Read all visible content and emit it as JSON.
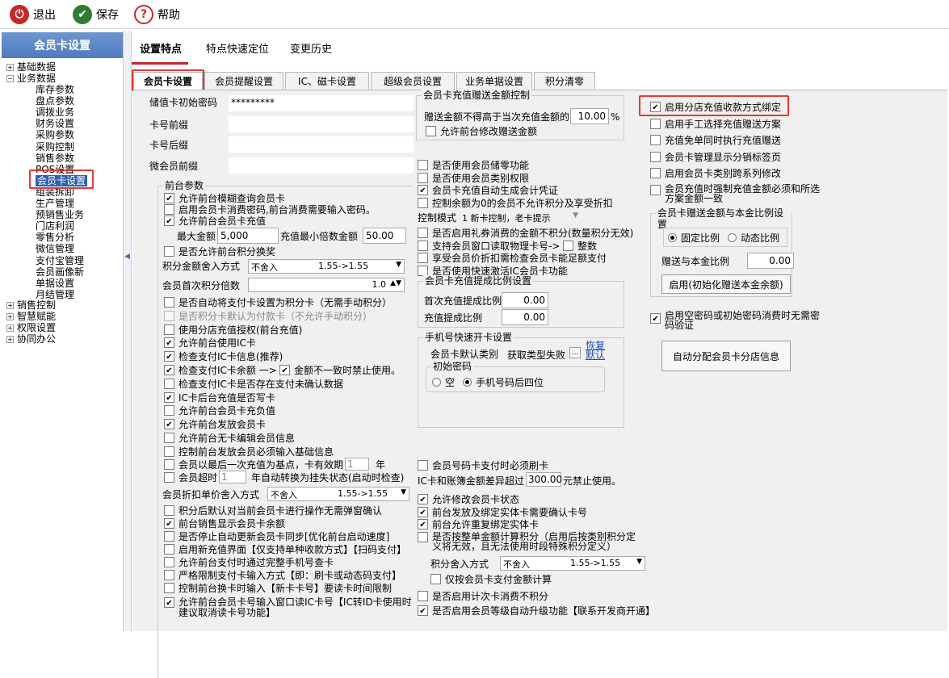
{
  "toolbar": {
    "exit": "退出",
    "save": "保存",
    "help": "帮助"
  },
  "sidebar": {
    "title": "会员卡设置",
    "top": [
      "基础数据",
      "业务数据"
    ],
    "sub": [
      "库存参数",
      "盘点参数",
      "调拨业务",
      "财务设置",
      "采购参数",
      "采购控制",
      "销售参数",
      "POS设置",
      "会员卡设置",
      "组装拆卸",
      "生产管理",
      "预销售业务",
      "门店利润",
      "零售分析",
      "微信管理",
      "支付宝管理",
      "会员画像新",
      "单据设置",
      "月结管理"
    ],
    "bottom": [
      "销售控制",
      "智慧赋能",
      "权限设置",
      "协同办公"
    ]
  },
  "tabs": {
    "top": [
      "设置特点",
      "特点快速定位",
      "变更历史"
    ],
    "sub": [
      "会员卡设置",
      "会员提醒设置",
      "IC、磁卡设置",
      "超级会员设置",
      "业务单据设置",
      "积分清零"
    ]
  },
  "col1": {
    "pwd_label": "储值卡初始密码",
    "pwd_value": "*********",
    "prefix_label": "卡号前缀",
    "suffix_label": "卡号后缀",
    "wx_prefix_label": "微会员前缀",
    "group_title": "前台参数",
    "cb1": "允许前台模糊查询会员卡",
    "cb2": "启用会员卡消费密码,前台消费需要输入密码。",
    "cb3": "允许前台会员卡充值",
    "max_label": "最大金额",
    "max_value": "5,000",
    "min_mult_label": "充值最小倍数金额",
    "min_mult_value": "50.00",
    "cb4": "是否允许前台积分换奖",
    "round_label": "积分金额舍入方式",
    "round_value": "不舍入",
    "round_eg": "1.55->1.55",
    "first_mult_label": "会员首次积分倍数",
    "first_mult_value": "1.0",
    "items": [
      {
        "t": "是否自动将支付卡设置为积分卡（无需手动积分）",
        "on": false
      },
      {
        "t": "是否积分卡默认为付款卡（不允许手动积分）",
        "on": false,
        "dim": true
      },
      {
        "t": "使用分店充值授权(前台充值)",
        "on": false
      },
      {
        "t": "允许前台使用IC卡",
        "on": true
      },
      {
        "t": "检查支付IC卡信息(推荐)",
        "on": true
      },
      {
        "t": "检查支付IC卡余额 一>",
        "on": true
      },
      {
        "t": "检查支付IC卡是否存在支付未确认数据",
        "on": false
      },
      {
        "t": "IC卡后台充值是否写卡",
        "on": true
      },
      {
        "t": "允许前台会员卡充负值",
        "on": false
      },
      {
        "t": "允许前台发放会员卡",
        "on": true
      },
      {
        "t": "允许前台无卡编辑会员信息",
        "on": false
      },
      {
        "t": "控制前台发放会员必须输入基础信息",
        "on": false
      }
    ],
    "mismatch": "金额不一致时禁止使用。",
    "last_recharge": "会员以最后一次充值为基点，卡有效期",
    "last_recharge_val": "1",
    "last_recharge_unit": "年",
    "over": "会员超时",
    "over_val": "1",
    "over_tail": "年自动转换为挂失状态(启动时检查)",
    "disc_label": "会员折扣单价舍入方式",
    "disc_value": "不舍入",
    "disc_eg": "1.55->1.55",
    "items2": [
      {
        "t": "积分后默认对当前会员卡进行操作无需弹窗确认",
        "on": false
      },
      {
        "t": "前台销售显示会员卡余额",
        "on": true
      },
      {
        "t": "是否停止自动更新会员卡同步[优化前台启动速度]",
        "on": false
      },
      {
        "t": "启用新充值界面【仅支持单种收款方式】【扫码支付】",
        "on": false
      },
      {
        "t": "允许前台支付时通过完整手机号查卡",
        "on": false
      },
      {
        "t": "严格限制支付卡输入方式【即：刷卡或动态码支付】",
        "on": false
      },
      {
        "t": "控制前台换卡时输入【新卡卡号】要读卡时间限制",
        "on": false
      }
    ],
    "last": "允许前台会员卡号输入窗口读IC卡号【IC转ID卡使用时建议取消读卡号功能】"
  },
  "col2": {
    "g1_title": "会员卡充值赠送金额控制",
    "gift_label": "赠送金额不得高于当次充值金额的",
    "gift_value": "10.00",
    "gift_unit": "%",
    "gift_cb": "允许前台修改赠送金额",
    "items": [
      {
        "t": "是否使用会员储零功能",
        "on": false
      },
      {
        "t": "是否使用会员类别权限",
        "on": false
      },
      {
        "t": "会员卡充值自动生成会计凭证",
        "on": true
      },
      {
        "t": "控制余额为0的会员不允许积分及享受折扣",
        "on": false
      }
    ],
    "mode_label": "控制模式",
    "mode_value": "1 新卡控制，老卡提示",
    "items2": [
      {
        "t": "是否启用礼券消费的金额不积分(数量积分无效)",
        "on": false
      },
      {
        "t": "支持会员窗口读取物理卡号->",
        "on": false
      },
      {
        "t": "享受会员价折扣需检查会员卡能足额支付",
        "on": false
      },
      {
        "t": "是否使用快速激活IC会员卡功能",
        "on": false
      }
    ],
    "whole": "整数",
    "g2_title": "会员卡充值提成比例设置",
    "first_ratio_label": "首次充值提成比例",
    "first_ratio": "0.00",
    "ratio_label": "充值提成比例",
    "ratio": "0.00",
    "g3_title": "手机号快速开卡设置",
    "default_cat_label": "会员卡默认类别",
    "default_cat": "获取类型失败",
    "restore": "恢复默认",
    "g4_title": "初始密码",
    "pwd_opt1": "空",
    "pwd_opt2": "手机号码后四位",
    "card_pay": "会员号码卡支付时必须刷卡",
    "diff_label": "IC卡和账簿金额差异超过",
    "diff_value": "300.00",
    "diff_tail": "元禁止使用。",
    "items3": [
      {
        "t": "允许修改会员卡状态",
        "on": true
      },
      {
        "t": "前台发放及绑定实体卡需要确认卡号",
        "on": true
      },
      {
        "t": "前台允许重复绑定实体卡",
        "on": true
      },
      {
        "t": "是否按整单金额计算积分（启用后按类别积分定义将无效，且无法使用时段特殊积分定义）",
        "on": false
      }
    ],
    "round2_label": "积分舍入方式",
    "round2_value": "不舍入",
    "round2_eg": "1.55->1.55",
    "only_pay": "仅按会员卡支付金额计算",
    "count_card": "是否启用计次卡消费不积分",
    "auto_upgrade": "是否启用会员等级自动升级功能【联系开发商开通】"
  },
  "col3": {
    "items": [
      {
        "t": "启用分店充值收款方式绑定",
        "on": true
      },
      {
        "t": "启用手工选择充值赠送方案",
        "on": false
      },
      {
        "t": "充值免单同时执行充值赠送",
        "on": false
      },
      {
        "t": "会员卡管理显示分销标签页",
        "on": false
      },
      {
        "t": "启用会员卡类别跨系列修改",
        "on": false
      },
      {
        "t": "会员充值时强制充值金额必须和所选方案金额一致",
        "on": false
      }
    ],
    "g_title": "会员卡赠送金额与本金比例设置",
    "opt1": "固定比例",
    "opt2": "动态比例",
    "ratio_label": "赠送与本金比例",
    "ratio": "0.00",
    "init_btn": "启用(初始化赠送本金余额)",
    "verify": "启用空密码或初始密码消费时无需密码验证",
    "auto_btn": "自动分配会员卡分店信息"
  }
}
